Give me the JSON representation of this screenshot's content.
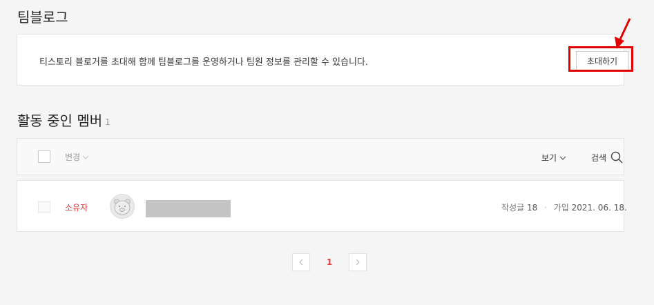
{
  "header": {
    "title": "팀블로그"
  },
  "invite": {
    "description": "티스토리 블로거를 초대해 함께 팀블로그를 운영하거나 팀원 정보를 관리할 수 있습니다.",
    "button_label": "초대하기"
  },
  "members_section": {
    "title": "활동 중인 멤버",
    "count": "1"
  },
  "toolbar": {
    "change_label": "변경",
    "view_label": "보기",
    "search_label": "검색"
  },
  "members": [
    {
      "role": "소유자",
      "posts_label": "작성글",
      "posts_count": "18",
      "join_label": "가입",
      "join_date": "2021. 06. 18."
    }
  ],
  "pagination": {
    "current_page": "1"
  },
  "colors": {
    "accent": "#e03c3c",
    "highlight": "#e00000"
  },
  "icons": [
    "checkbox-icon",
    "chevron-down-icon",
    "search-icon",
    "avatar-icon",
    "chevron-left-icon",
    "chevron-right-icon",
    "arrow-icon"
  ]
}
